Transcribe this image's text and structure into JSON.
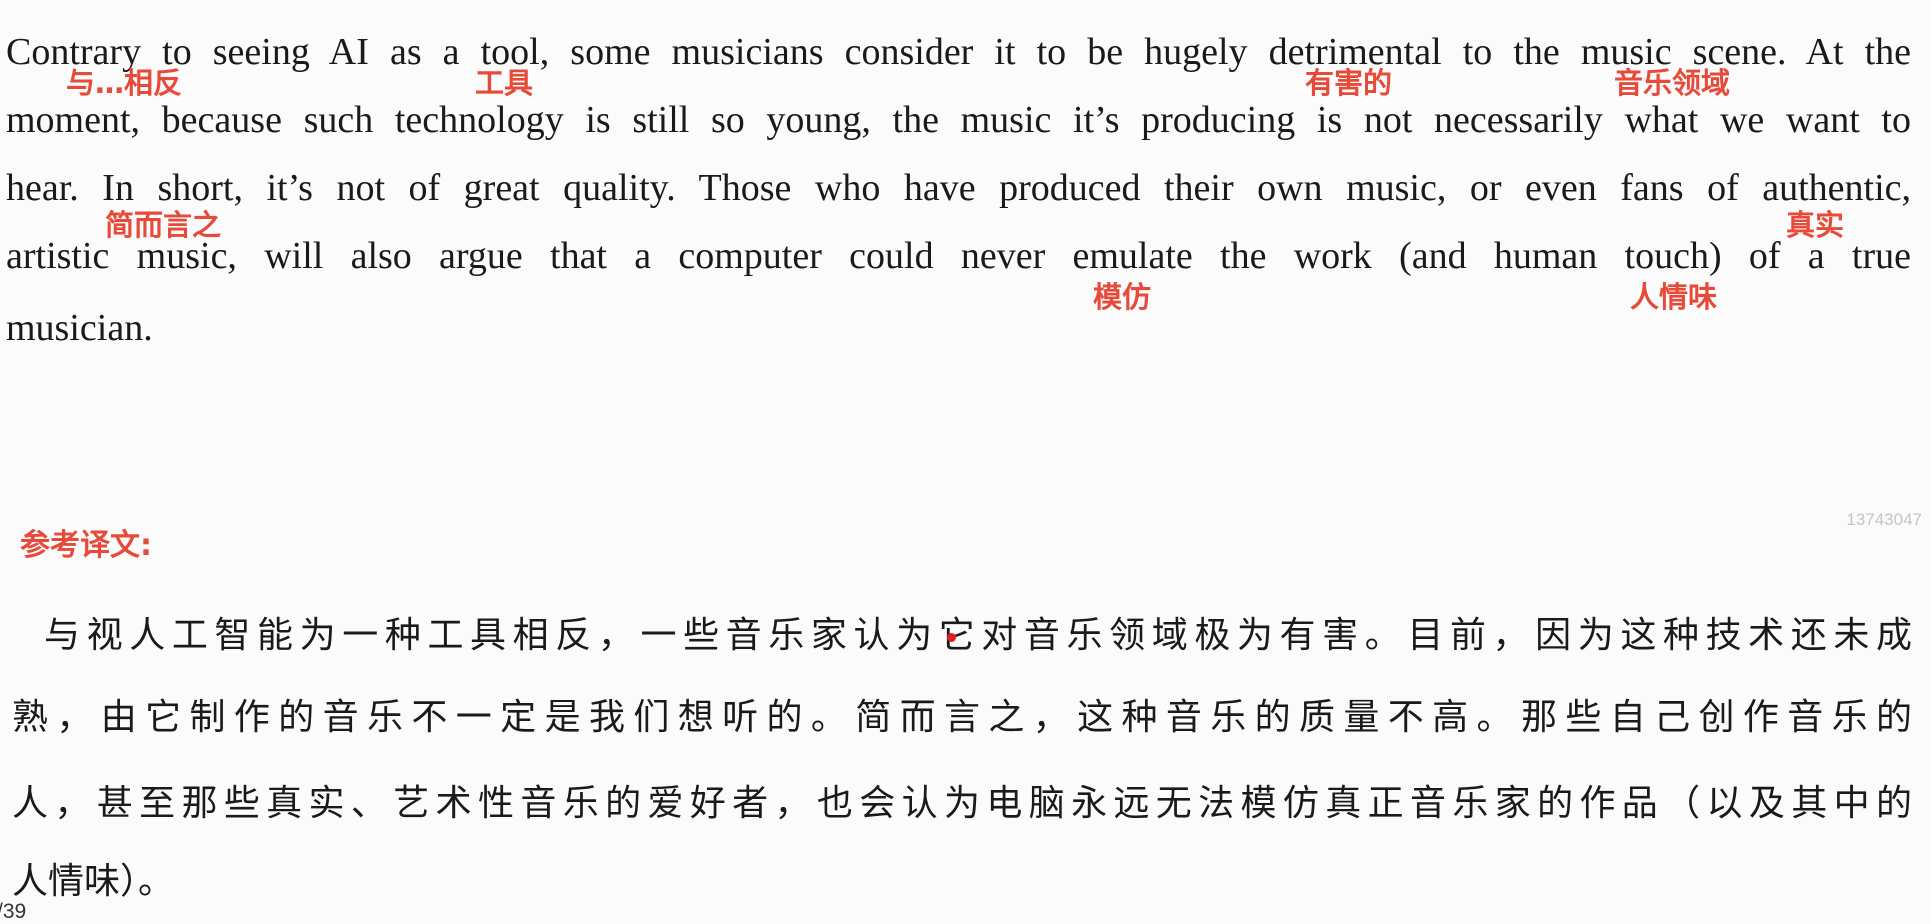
{
  "passage": {
    "lines": [
      "Contrary to seeing AI as a tool, some musicians consider it to be hugely detrimental to the music scene. At the",
      "moment, because such technology is still so young, the music it’s producing is not necessarily what we want to",
      "hear. In short, it’s not of great quality. Those who have produced their own music, or even fans of authentic,",
      "artistic music, will also argue that a computer could never emulate the work (and human touch) of a true",
      "musician."
    ]
  },
  "annotations": [
    "与…相反",
    "工具",
    "有害的",
    "音乐领域",
    "简而言之",
    "真实",
    "模仿",
    "人情味"
  ],
  "watermark": "13743047",
  "translation": {
    "heading": "参考译文:",
    "lines": [
      "与视人工智能为一种工具相反，一些音乐家认为它对音乐领域极为有害。目前，因为这种技术还未成",
      "熟，由它制作的音乐不一定是我们想听的。简而言之，这种音乐的质量不高。那些自己创作音乐的",
      "人，甚至那些真实、艺术性音乐的爱好者，也会认为电脑永远无法模仿真正音乐家的作品（以及其中的",
      "人情味）。"
    ]
  },
  "page_number": "/39",
  "colors": {
    "annotation": "#e84a3a",
    "text": "#1a1a1a",
    "background": "#fbfbfb"
  }
}
